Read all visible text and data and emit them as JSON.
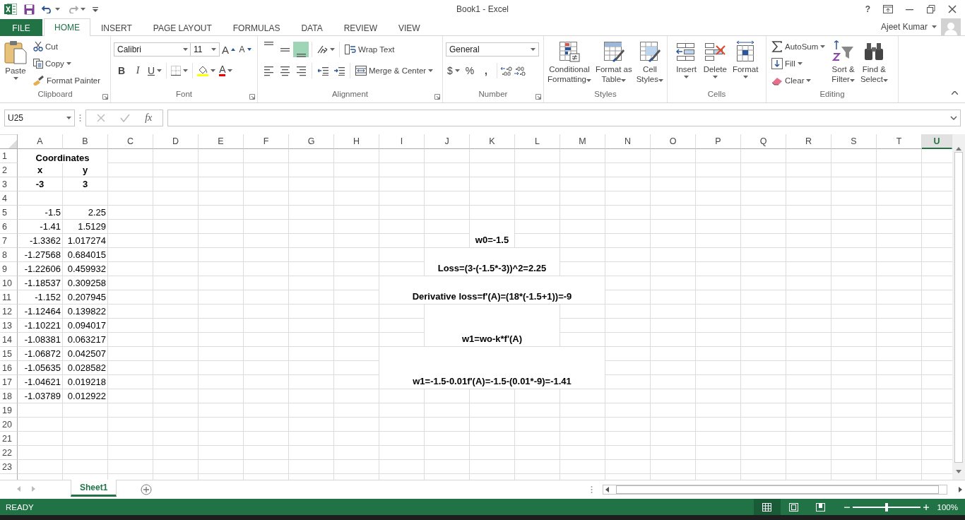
{
  "window": {
    "title": "Book1 - Excel",
    "help": "?"
  },
  "tabs": [
    {
      "label": "FILE",
      "kind": "file",
      "selected": false
    },
    {
      "label": "HOME",
      "kind": "tab",
      "selected": true
    },
    {
      "label": "INSERT",
      "kind": "tab",
      "selected": false
    },
    {
      "label": "PAGE LAYOUT",
      "kind": "tab",
      "selected": false
    },
    {
      "label": "FORMULAS",
      "kind": "tab",
      "selected": false
    },
    {
      "label": "DATA",
      "kind": "tab",
      "selected": false
    },
    {
      "label": "REVIEW",
      "kind": "tab",
      "selected": false
    },
    {
      "label": "VIEW",
      "kind": "tab",
      "selected": false
    }
  ],
  "user": {
    "name": "Ajeet Kumar"
  },
  "ribbon": {
    "clipboard": {
      "label": "Clipboard",
      "paste": "Paste",
      "items": [
        "Cut",
        "Copy",
        "Format Painter"
      ]
    },
    "font": {
      "label": "Font",
      "font_name": "Calibri",
      "font_size": "11",
      "grow": "A",
      "shrink": "A",
      "styles": [
        "B",
        "I",
        "U"
      ],
      "font_color": "A"
    },
    "alignment": {
      "label": "Alignment",
      "vertical": [
        {
          "selected": false
        },
        {
          "selected": false
        },
        {
          "selected": true
        }
      ],
      "wrap": "Wrap Text",
      "merge": "Merge & Center"
    },
    "number": {
      "label": "Number",
      "format": "General",
      "currency": "$",
      "percent": "%",
      "comma": ","
    },
    "styles": {
      "label": "Styles",
      "buttons": [
        "Conditional\nFormatting",
        "Format as\nTable",
        "Cell\nStyles"
      ]
    },
    "cells": {
      "label": "Cells",
      "buttons": [
        "Insert",
        "Delete",
        "Format"
      ]
    },
    "editing": {
      "label": "Editing",
      "small": [
        "AutoSum",
        "Fill",
        "Clear"
      ],
      "large": [
        "Sort &\nFilter",
        "Find &\nSelect"
      ]
    }
  },
  "formula_bar": {
    "name_box": "U25",
    "fx": "fx"
  },
  "sheet": {
    "columns": [
      {
        "label": "A",
        "selected": false
      },
      {
        "label": "B",
        "selected": false
      },
      {
        "label": "C",
        "selected": false
      },
      {
        "label": "D",
        "selected": false
      },
      {
        "label": "E",
        "selected": false
      },
      {
        "label": "F",
        "selected": false
      },
      {
        "label": "G",
        "selected": false
      },
      {
        "label": "H",
        "selected": false
      },
      {
        "label": "I",
        "selected": false
      },
      {
        "label": "J",
        "selected": false
      },
      {
        "label": "K",
        "selected": false
      },
      {
        "label": "L",
        "selected": false
      },
      {
        "label": "M",
        "selected": false
      },
      {
        "label": "N",
        "selected": false
      },
      {
        "label": "O",
        "selected": false
      },
      {
        "label": "P",
        "selected": false
      },
      {
        "label": "Q",
        "selected": false
      },
      {
        "label": "R",
        "selected": false
      },
      {
        "label": "S",
        "selected": false
      },
      {
        "label": "T",
        "selected": false
      },
      {
        "label": "U",
        "selected": true
      }
    ],
    "rows": [
      {
        "header": "1",
        "kind": "title",
        "cells": [
          "Coordinates"
        ]
      },
      {
        "header": "2",
        "kind": "heading",
        "cells": [
          "x",
          "y"
        ]
      },
      {
        "header": "3",
        "kind": "heading",
        "cells": [
          "-3",
          "3"
        ]
      },
      {
        "header": "4",
        "cells": []
      },
      {
        "header": "5",
        "kind": "number",
        "cells": [
          "-1.5",
          "2.25"
        ]
      },
      {
        "header": "6",
        "kind": "number",
        "cells": [
          "-1.41",
          "1.5129"
        ]
      },
      {
        "header": "7",
        "kind": "number",
        "cells": [
          "-1.3362",
          "1.017274"
        ]
      },
      {
        "header": "8",
        "kind": "number",
        "cells": [
          "-1.27568",
          "0.684015"
        ]
      },
      {
        "header": "9",
        "kind": "number",
        "cells": [
          "-1.22606",
          "0.459932"
        ]
      },
      {
        "header": "10",
        "kind": "number",
        "cells": [
          "-1.18537",
          "0.309258"
        ]
      },
      {
        "header": "11",
        "kind": "number",
        "cells": [
          "-1.152",
          "0.207945"
        ]
      },
      {
        "header": "12",
        "kind": "number",
        "cells": [
          "-1.12464",
          "0.139822"
        ]
      },
      {
        "header": "13",
        "kind": "number",
        "cells": [
          "-1.10221",
          "0.094017"
        ]
      },
      {
        "header": "14",
        "kind": "number",
        "cells": [
          "-1.08381",
          "0.063217"
        ]
      },
      {
        "header": "15",
        "kind": "number",
        "cells": [
          "-1.06872",
          "0.042507"
        ]
      },
      {
        "header": "16",
        "kind": "number",
        "cells": [
          "-1.05635",
          "0.028582"
        ]
      },
      {
        "header": "17",
        "kind": "number",
        "cells": [
          "-1.04621",
          "0.019218"
        ]
      },
      {
        "header": "18",
        "kind": "number",
        "cells": [
          "-1.03789",
          "0.012922"
        ]
      },
      {
        "header": "19",
        "cells": []
      },
      {
        "header": "20",
        "cells": []
      },
      {
        "header": "21",
        "cells": []
      },
      {
        "header": "22",
        "cells": []
      },
      {
        "header": "23",
        "cells": []
      }
    ],
    "notes": [
      "w0=-1.5",
      "Loss=(3-(-1.5*-3))^2=2.25",
      "Derivative loss=f'(A)=(18*(-1.5+1))=-9",
      "w1=wo-k*f'(A)",
      "w1=-1.5-0.01f'(A)=-1.5-(0.01*-9)=-1.41"
    ]
  },
  "sheet_tabs": [
    {
      "label": "Sheet1",
      "selected": true
    }
  ],
  "status_bar": {
    "mode": "READY",
    "views": [
      {
        "selected": true
      },
      {
        "selected": false
      },
      {
        "selected": false
      }
    ],
    "zoom": {
      "level": 0.5,
      "reading": "100%"
    }
  }
}
